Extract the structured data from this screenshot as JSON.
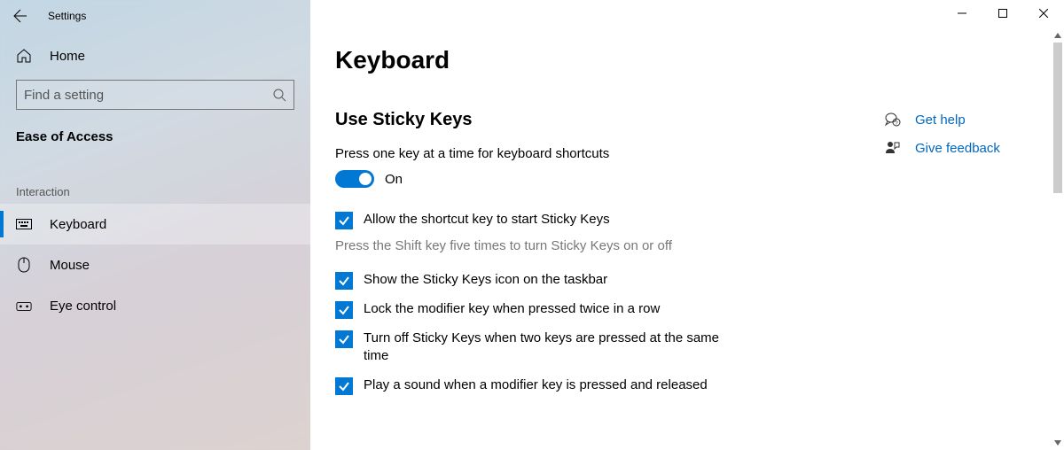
{
  "app_title": "Settings",
  "sidebar": {
    "home": "Home",
    "search_placeholder": "Find a setting",
    "category": "Ease of Access",
    "group": "Interaction",
    "items": [
      {
        "label": "Keyboard"
      },
      {
        "label": "Mouse"
      },
      {
        "label": "Eye control"
      }
    ]
  },
  "page": {
    "title": "Keyboard",
    "section": "Use Sticky Keys",
    "desc": "Press one key at a time for keyboard shortcuts",
    "toggle_state": "On",
    "check1": "Allow the shortcut key to start Sticky Keys",
    "hint": "Press the Shift key five times to turn Sticky Keys on or off",
    "check2": "Show the Sticky Keys icon on the taskbar",
    "check3": "Lock the modifier key when pressed twice in a row",
    "check4": "Turn off Sticky Keys when two keys are pressed at the same time",
    "check5": "Play a sound when a modifier key is pressed and released"
  },
  "help": {
    "get_help": "Get help",
    "feedback": "Give feedback"
  }
}
